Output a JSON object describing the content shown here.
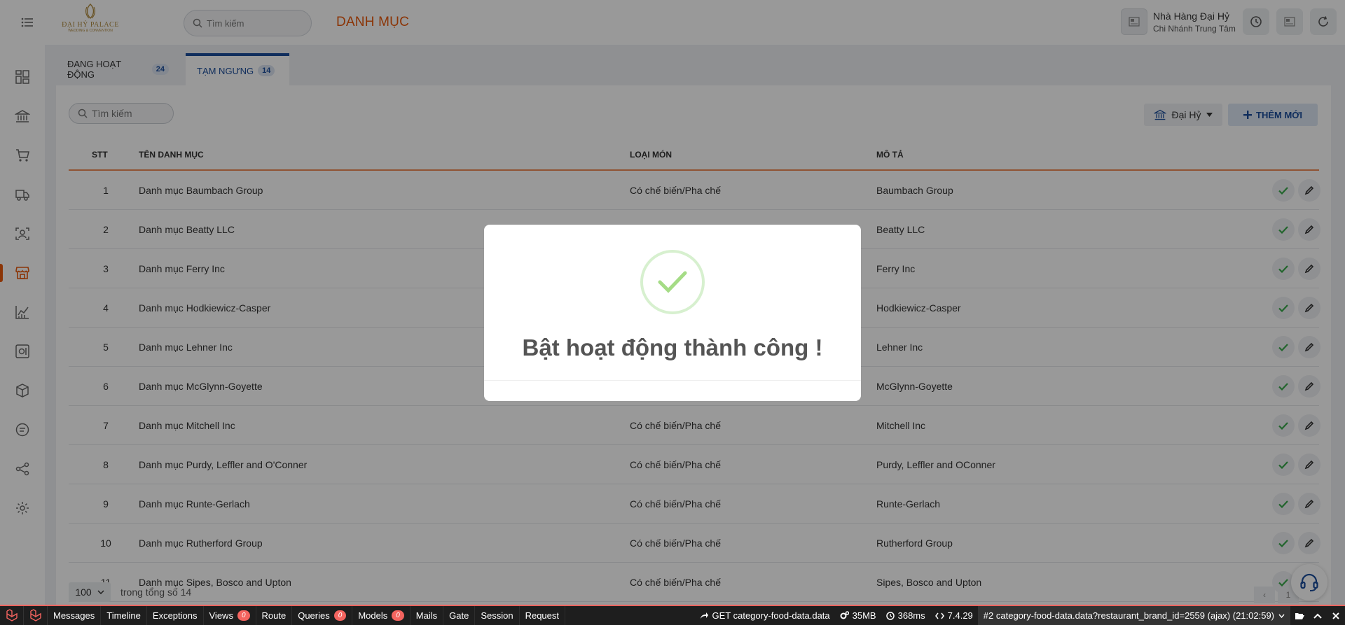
{
  "header": {
    "logo_text": "ĐẠI HỶ PALACE",
    "logo_sub": "WEDDING & CONVENTION",
    "search_placeholder": "Tìm kiếm",
    "page_title": "DANH MỤC",
    "store_name": "Nhà Hàng Đại Hỷ",
    "store_branch": "Chi Nhánh Trung Tâm"
  },
  "tabs": [
    {
      "label": "ĐANG HOẠT ĐỘNG",
      "count": "24"
    },
    {
      "label": "TẠM NGƯNG",
      "count": "14"
    }
  ],
  "toolbar": {
    "search_placeholder": "Tìm kiếm",
    "brand_label": "Đại Hỷ",
    "add_label": "THÊM MỚI"
  },
  "table": {
    "columns": [
      "STT",
      "TÊN DANH MỤC",
      "LOẠI MÓN",
      "MÔ TẢ"
    ],
    "rows": [
      {
        "stt": "1",
        "name": "Danh mục Baumbach Group",
        "type": "Có chế biến/Pha chế",
        "desc": "Baumbach Group"
      },
      {
        "stt": "2",
        "name": "Danh mục Beatty LLC",
        "type": "",
        "desc": "Beatty LLC"
      },
      {
        "stt": "3",
        "name": "Danh mục Ferry Inc",
        "type": "",
        "desc": "Ferry Inc"
      },
      {
        "stt": "4",
        "name": "Danh mục Hodkiewicz-Casper",
        "type": "",
        "desc": "Hodkiewicz-Casper"
      },
      {
        "stt": "5",
        "name": "Danh mục Lehner Inc",
        "type": "",
        "desc": "Lehner Inc"
      },
      {
        "stt": "6",
        "name": "Danh mục McGlynn-Goyette",
        "type": "",
        "desc": "McGlynn-Goyette"
      },
      {
        "stt": "7",
        "name": "Danh mục Mitchell Inc",
        "type": "Có chế biến/Pha chế",
        "desc": "Mitchell Inc"
      },
      {
        "stt": "8",
        "name": "Danh mục Purdy, Leffler and O'Conner",
        "type": "Có chế biến/Pha chế",
        "desc": "Purdy, Leffler and OConner"
      },
      {
        "stt": "9",
        "name": "Danh mục Runte-Gerlach",
        "type": "Có chế biến/Pha chế",
        "desc": "Runte-Gerlach"
      },
      {
        "stt": "10",
        "name": "Danh mục Rutherford Group",
        "type": "Có chế biến/Pha chế",
        "desc": "Rutherford Group"
      },
      {
        "stt": "11",
        "name": "Danh mục Sipes, Bosco and Upton",
        "type": "Có chế biến/Pha chế",
        "desc": "Sipes, Bosco and Upton"
      }
    ]
  },
  "footer": {
    "per_page": "100",
    "total_text": "trong tổng số 14",
    "page_prev": "‹",
    "page_current": "1"
  },
  "modal": {
    "message": "Bật hoạt động thành công !"
  },
  "debugbar": {
    "tabs": [
      {
        "label": "Messages",
        "badge": ""
      },
      {
        "label": "Timeline",
        "badge": ""
      },
      {
        "label": "Exceptions",
        "badge": ""
      },
      {
        "label": "Views",
        "badge": "0"
      },
      {
        "label": "Route",
        "badge": ""
      },
      {
        "label": "Queries",
        "badge": "0"
      },
      {
        "label": "Models",
        "badge": "0"
      },
      {
        "label": "Mails",
        "badge": ""
      },
      {
        "label": "Gate",
        "badge": ""
      },
      {
        "label": "Session",
        "badge": ""
      },
      {
        "label": "Request",
        "badge": ""
      }
    ],
    "route": "GET category-food-data.data",
    "memory": "35MB",
    "duration": "368ms",
    "php_version": "7.4.29",
    "request": "#2 category-food-data.data?restaurant_brand_id=2559 (ajax) (21:02:59)"
  },
  "colors": {
    "accent": "#e8590c",
    "primary": "#1b4d9b",
    "success": "#3aa84b"
  }
}
